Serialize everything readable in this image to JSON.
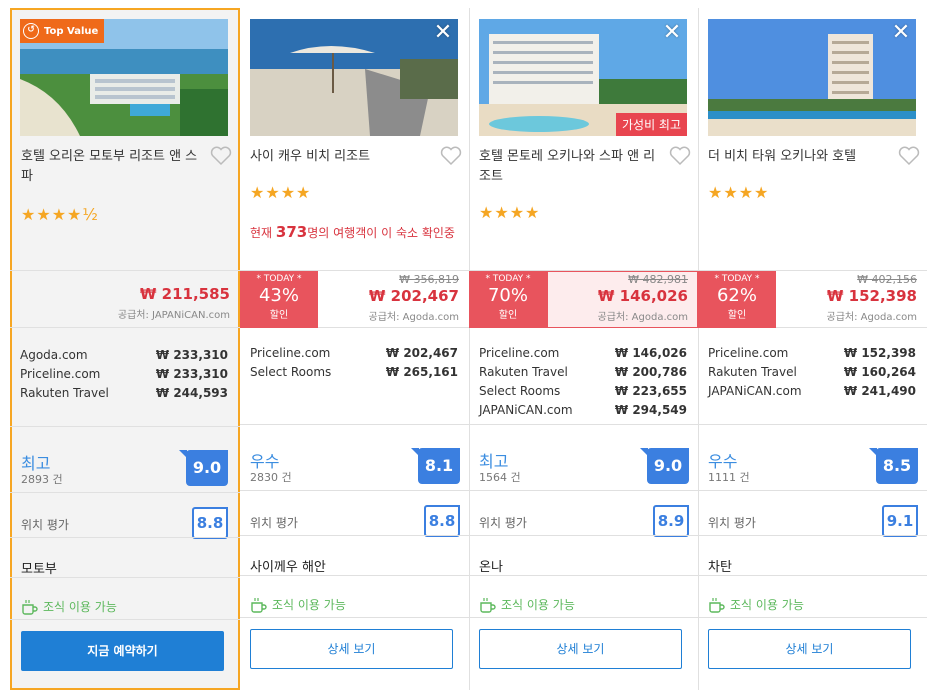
{
  "colors": {
    "accent": "#1f7fd5",
    "price_red": "#d8333e",
    "today_red": "#e8545d",
    "top_value_orange": "#ef6a1a",
    "selected_border": "#f6a623",
    "breakfast_green": "#5cb85c"
  },
  "hotels": [
    {
      "badge": "Top Value",
      "name": "호텔 오리온 모토부 리조트 앤 스파",
      "stars": "★★★★½",
      "price": "₩ 211,585",
      "supplier": "공급처: JAPANiCAN.com",
      "deals": [
        {
          "site": "Agoda.com",
          "price": "₩ 233,310"
        },
        {
          "site": "Priceline.com",
          "price": "₩ 233,310"
        },
        {
          "site": "Rakuten Travel",
          "price": "₩ 244,593"
        }
      ],
      "rating_word": "최고",
      "rating_count": "2893 건",
      "score": "9.0",
      "location_label": "위치 평가",
      "location_score": "8.8",
      "area": "모토부",
      "breakfast": "조식 이용 가능",
      "button": "지금 예약하기"
    },
    {
      "name": "사이 캐우 비치 리조트",
      "stars": "★★★★",
      "viewers_prefix": "현재 ",
      "viewers_count": "373",
      "viewers_suffix": "명의 여행객이 이 숙소 확인중",
      "today_label": "* TODAY *",
      "discount": "43%",
      "discount_label": "할인",
      "old_price": "₩ 356,819",
      "price": "₩ 202,467",
      "supplier": "공급처: Agoda.com",
      "deals": [
        {
          "site": "Priceline.com",
          "price": "₩ 202,467"
        },
        {
          "site": "Select Rooms",
          "price": "₩ 265,161"
        }
      ],
      "rating_word": "우수",
      "rating_count": "2830 건",
      "score": "8.1",
      "location_label": "위치 평가",
      "location_score": "8.8",
      "area": "사이께우 해안",
      "breakfast": "조식 이용 가능",
      "button": "상세 보기"
    },
    {
      "name": "호텔 몬토레 오키나와 스파 앤 리조트",
      "stars": "★★★★",
      "photo_tag": "가성비 최고",
      "today_label": "* TODAY *",
      "discount": "70%",
      "discount_label": "할인",
      "old_price": "₩ 482,981",
      "price": "₩ 146,026",
      "supplier": "공급처: Agoda.com",
      "deals": [
        {
          "site": "Priceline.com",
          "price": "₩ 146,026"
        },
        {
          "site": "Rakuten Travel",
          "price": "₩ 200,786"
        },
        {
          "site": "Select Rooms",
          "price": "₩ 223,655"
        },
        {
          "site": "JAPANiCAN.com",
          "price": "₩ 294,549"
        }
      ],
      "rating_word": "최고",
      "rating_count": "1564 건",
      "score": "9.0",
      "location_label": "위치 평가",
      "location_score": "8.9",
      "area": "온나",
      "breakfast": "조식 이용 가능",
      "button": "상세 보기"
    },
    {
      "name": "더 비치 타워 오키나와 호텔",
      "stars": "★★★★",
      "today_label": "* TODAY *",
      "discount": "62%",
      "discount_label": "할인",
      "old_price": "₩ 402,156",
      "price": "₩ 152,398",
      "supplier": "공급처: Agoda.com",
      "deals": [
        {
          "site": "Priceline.com",
          "price": "₩ 152,398"
        },
        {
          "site": "Rakuten Travel",
          "price": "₩ 160,264"
        },
        {
          "site": "JAPANiCAN.com",
          "price": "₩ 241,490"
        }
      ],
      "rating_word": "우수",
      "rating_count": "1111 건",
      "score": "8.5",
      "location_label": "위치 평가",
      "location_score": "9.1",
      "area": "차탄",
      "breakfast": "조식 이용 가능",
      "button": "상세 보기"
    }
  ]
}
